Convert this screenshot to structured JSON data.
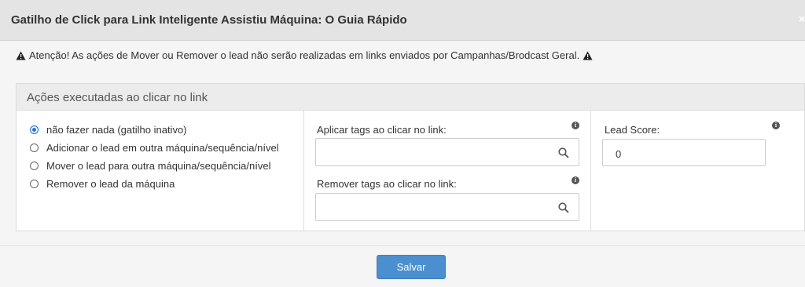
{
  "modal": {
    "title": "Gatilho de Click para Link Inteligente Assistiu Máquina: O Guia Rápido",
    "close": "×"
  },
  "warning": {
    "text": "Atenção! As ações de Mover ou Remover o lead não serão realizadas em links enviados por Campanhas/Brodcast Geral."
  },
  "panel": {
    "title": "Ações executadas ao clicar no link",
    "options": [
      {
        "label": "não fazer nada (gatilho inativo)",
        "checked": true
      },
      {
        "label": "Adicionar o lead em outra máquina/sequência/nível",
        "checked": false
      },
      {
        "label": "Mover o lead para outra máquina/sequência/nível",
        "checked": false
      },
      {
        "label": "Remover o lead da máquina",
        "checked": false
      }
    ],
    "apply_tags": {
      "label": "Aplicar tags ao clicar no link:",
      "value": ""
    },
    "remove_tags": {
      "label": "Remover tags ao clicar no link:",
      "value": ""
    },
    "lead_score": {
      "label": "Lead Score:",
      "value": "0"
    }
  },
  "footer": {
    "save_label": "Salvar"
  },
  "colors": {
    "primary_button": "#4a8fd0",
    "radio_checked": "#1a73e8"
  }
}
